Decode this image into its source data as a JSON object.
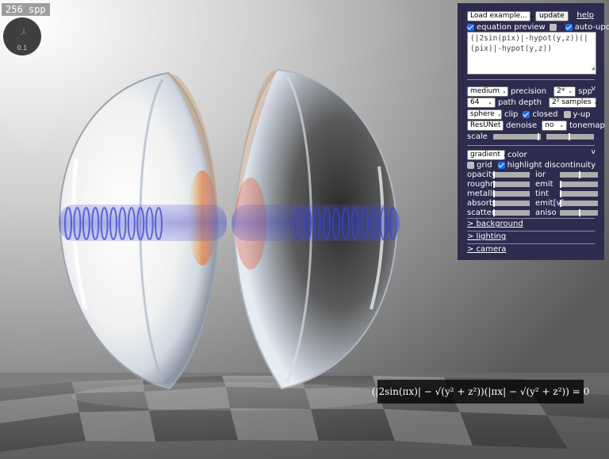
{
  "viewport": {
    "spp_counter": "256 spp",
    "gizmo_zoom": "0.1",
    "equation_overlay": "(|2sin(πx)| − √(y² + z²))(|πx| − √(y² + z²)) = 0"
  },
  "panel": {
    "load_example": "Load example...",
    "update": "update",
    "help": "help",
    "equation_preview": {
      "label": "equation preview",
      "checked": true
    },
    "unlabeled_toggle": {
      "checked": false
    },
    "auto_update": {
      "label": "auto-update",
      "checked": true
    },
    "equation_text": "(|2sin(pix)|-hypot(y,z))(|(pix)|-hypot(y,z))",
    "render": {
      "quality": "medium",
      "precision_label": "precision",
      "spp_select": "2*",
      "spp_label": "spp",
      "path_depth_select": "64",
      "path_depth_label": "path depth",
      "samples_select": "2² samples",
      "clip_select": "sphere",
      "clip_label": "clip",
      "closed": {
        "label": "closed",
        "checked": true
      },
      "y_up": {
        "label": "y-up",
        "checked": false
      },
      "denoiser_select": "ResUNet",
      "denoise_label": "denoise",
      "tonemap_select": "no",
      "tonemap_label": "tonemap",
      "scale_label": "scale",
      "collapse": "v"
    },
    "material": {
      "color_select": "gradient",
      "color_label": "color",
      "grid": {
        "label": "grid",
        "checked": false
      },
      "highlight": {
        "label": "highlight discontinuity",
        "checked": true
      },
      "opacity": "opacity",
      "ior": "ior",
      "roughness": "roughness",
      "emit": "emit",
      "metallic": "metallic",
      "tint": "tint",
      "absorb": "absorb",
      "emit_v": "emit[v]",
      "scatter": "scatter",
      "aniso": "aniso",
      "collapse": "v"
    },
    "sections": {
      "background": "> background",
      "lighting": "> lighting",
      "camera": "> camera"
    }
  }
}
